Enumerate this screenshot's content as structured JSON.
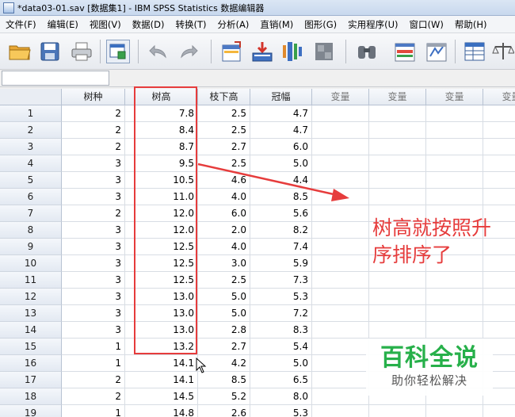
{
  "window": {
    "title": "*data03-01.sav [数据集1] - IBM SPSS Statistics 数据编辑器"
  },
  "menu": [
    "文件(F)",
    "编辑(E)",
    "视图(V)",
    "数据(D)",
    "转换(T)",
    "分析(A)",
    "直销(M)",
    "图形(G)",
    "实用程序(U)",
    "窗口(W)",
    "帮助(H)"
  ],
  "toolbar_icons": [
    "open-folder-icon",
    "save-icon",
    "print-icon",
    "dialog-recall-icon",
    "undo-icon",
    "redo-icon",
    "goto-case-icon",
    "goto-variable-icon",
    "variables-icon",
    "run-descriptives-icon",
    "find-icon",
    "insert-cases-icon",
    "insert-variable-icon",
    "split-file-icon",
    "weight-cases-icon"
  ],
  "columns": [
    "树种",
    "树高",
    "枝下高",
    "冠幅",
    "变量",
    "变量",
    "变量",
    "变量"
  ],
  "rows": [
    {
      "n": "1",
      "c": [
        "2",
        "7.8",
        "2.5",
        "4.7"
      ]
    },
    {
      "n": "2",
      "c": [
        "2",
        "8.4",
        "2.5",
        "4.7"
      ]
    },
    {
      "n": "3",
      "c": [
        "2",
        "8.7",
        "2.7",
        "6.0"
      ]
    },
    {
      "n": "4",
      "c": [
        "3",
        "9.5",
        "2.5",
        "5.0"
      ]
    },
    {
      "n": "5",
      "c": [
        "3",
        "10.5",
        "4.6",
        "4.4"
      ]
    },
    {
      "n": "6",
      "c": [
        "3",
        "11.0",
        "4.0",
        "8.5"
      ]
    },
    {
      "n": "7",
      "c": [
        "2",
        "12.0",
        "6.0",
        "5.6"
      ]
    },
    {
      "n": "8",
      "c": [
        "3",
        "12.0",
        "2.0",
        "8.2"
      ]
    },
    {
      "n": "9",
      "c": [
        "3",
        "12.5",
        "4.0",
        "7.4"
      ]
    },
    {
      "n": "10",
      "c": [
        "3",
        "12.5",
        "3.0",
        "5.9"
      ]
    },
    {
      "n": "11",
      "c": [
        "3",
        "12.5",
        "2.5",
        "7.3"
      ]
    },
    {
      "n": "12",
      "c": [
        "3",
        "13.0",
        "5.0",
        "5.3"
      ]
    },
    {
      "n": "13",
      "c": [
        "3",
        "13.0",
        "5.0",
        "7.2"
      ]
    },
    {
      "n": "14",
      "c": [
        "3",
        "13.0",
        "2.8",
        "8.3"
      ]
    },
    {
      "n": "15",
      "c": [
        "1",
        "13.2",
        "2.7",
        "5.4"
      ]
    },
    {
      "n": "16",
      "c": [
        "1",
        "14.1",
        "4.2",
        "5.0"
      ]
    },
    {
      "n": "17",
      "c": [
        "2",
        "14.1",
        "8.5",
        "6.5"
      ]
    },
    {
      "n": "18",
      "c": [
        "2",
        "14.5",
        "5.2",
        "8.0"
      ]
    },
    {
      "n": "19",
      "c": [
        "1",
        "14.8",
        "2.6",
        "5.3"
      ]
    }
  ],
  "annotation": {
    "line1": "树高就按照升",
    "line2": "序排序了",
    "color": "#e63c3c"
  },
  "watermark": {
    "title": "百科全说",
    "subtitle": "助你轻松解决",
    "color": "#27b04a"
  }
}
